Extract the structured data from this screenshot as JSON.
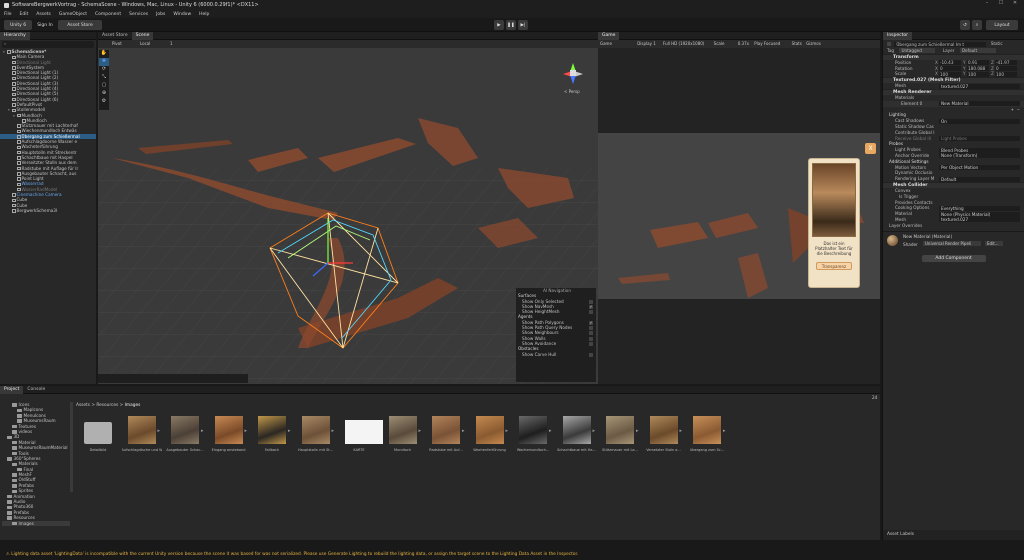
{
  "window": {
    "title": "SoftwareBergwerkVortrag - SchemaScene - Windows, Mac, Linux - Unity 6 (6000.0.29f1)* <DX11>"
  },
  "menu": [
    "File",
    "Edit",
    "Assets",
    "GameObject",
    "Component",
    "Services",
    "Jobs",
    "Window",
    "Help"
  ],
  "toolbar": {
    "unity": "Unity 6",
    "sign_in": "Sign In",
    "asset_store": "Asset Store",
    "layout": "Layout"
  },
  "hierarchy": {
    "tab": "Hierarchy",
    "items": [
      {
        "label": "SchemaScene*",
        "depth": 0,
        "style": "bold"
      },
      {
        "label": "Main Camera",
        "depth": 1,
        "style": ""
      },
      {
        "label": "Directional Light",
        "depth": 1,
        "style": "dim"
      },
      {
        "label": "EventSystem",
        "depth": 1,
        "style": ""
      },
      {
        "label": "Directional Light (1)",
        "depth": 1,
        "style": ""
      },
      {
        "label": "Directional Light (2)",
        "depth": 1,
        "style": ""
      },
      {
        "label": "Directional Light (3)",
        "depth": 1,
        "style": ""
      },
      {
        "label": "Directional Light (4)",
        "depth": 1,
        "style": ""
      },
      {
        "label": "Directional Light (5)",
        "depth": 1,
        "style": ""
      },
      {
        "label": "Directional Light (6)",
        "depth": 1,
        "style": ""
      },
      {
        "label": "DefaultPivot",
        "depth": 1,
        "style": ""
      },
      {
        "label": "Stollenmodell",
        "depth": 1,
        "style": ""
      },
      {
        "label": "Mundloch",
        "depth": 2,
        "style": ""
      },
      {
        "label": "Mundloch",
        "depth": 3,
        "style": ""
      },
      {
        "label": "Stützmauer mit Lachterhaf",
        "depth": 2,
        "style": ""
      },
      {
        "label": "Wiechenmundloch Entwäs",
        "depth": 2,
        "style": ""
      },
      {
        "label": "Übergang zum Schießermal",
        "depth": 2,
        "style": "sel"
      },
      {
        "label": "Aufschlagdoorne Wasser e",
        "depth": 2,
        "style": ""
      },
      {
        "label": "Wacheterführung",
        "depth": 2,
        "style": ""
      },
      {
        "label": "Hauptstolln mit Streckentr",
        "depth": 2,
        "style": ""
      },
      {
        "label": "Schachtbaue mit Haspel",
        "depth": 2,
        "style": ""
      },
      {
        "label": "Verseitzter Stolln aus dem",
        "depth": 2,
        "style": ""
      },
      {
        "label": "Radstube mit Auflage für Ir",
        "depth": 2,
        "style": ""
      },
      {
        "label": "Ausgebauter Schacht, aus",
        "depth": 2,
        "style": ""
      },
      {
        "label": "Point Light",
        "depth": 2,
        "style": ""
      },
      {
        "label": "Wasserrad",
        "depth": 2,
        "style": "blue"
      },
      {
        "label": "WasserRadModel",
        "depth": 2,
        "style": "dim"
      },
      {
        "label": "Cinemachine Camera",
        "depth": 1,
        "style": "blue"
      },
      {
        "label": "Cube",
        "depth": 1,
        "style": ""
      },
      {
        "label": "Cube",
        "depth": 1,
        "style": ""
      },
      {
        "label": "BergwerkSchema3I",
        "depth": 1,
        "style": ""
      }
    ]
  },
  "scene": {
    "tabs": [
      "Asset Store",
      "Scene"
    ],
    "pivot": "Pivot",
    "local": "Local",
    "grid_num": "1",
    "persp": "< Persp",
    "popup": {
      "text": "Das ist ein Platzhalter Text für die Beschreibung",
      "button": "Transparenz"
    },
    "navmesh": {
      "title": "AI Navigation",
      "sections": [
        {
          "head": "Surfaces",
          "items": [
            {
              "label": "Show Only Selected",
              "on": false
            },
            {
              "label": "Show NavMesh",
              "on": true
            },
            {
              "label": "Show HeightMesh",
              "on": false
            }
          ]
        },
        {
          "head": "Agents",
          "items": [
            {
              "label": "Show Path Polygons",
              "on": true
            },
            {
              "label": "Show Path Query Nodes",
              "on": false
            },
            {
              "label": "Show Neighbours",
              "on": false
            },
            {
              "label": "Show Walls",
              "on": false
            },
            {
              "label": "Show Avoidance",
              "on": false
            }
          ]
        },
        {
          "head": "Obstacles",
          "items": [
            {
              "label": "Show Carve Hull",
              "on": false
            }
          ]
        }
      ]
    }
  },
  "game": {
    "tab": "Game",
    "mode": "Game",
    "display": "Display 1",
    "res": "Full HD (1920x1080)",
    "scale": "Scale",
    "scale_val": "0.37x",
    "play": "Play Focused",
    "stats": "Stats",
    "gizmos": "Gizmos"
  },
  "inspector": {
    "tab": "Inspector",
    "name": "Übergang zum Schießermal Im t",
    "static": "Static",
    "tag_label": "Tag",
    "tag": "Untagged",
    "layer_label": "Layer",
    "layer": "Default",
    "transform": {
      "title": "Transform",
      "rows": [
        {
          "label": "Position",
          "x": "-10.43",
          "y": "0.91",
          "z": "-41.97"
        },
        {
          "label": "Rotation",
          "x": "0",
          "y": "180.088",
          "z": "0"
        },
        {
          "label": "Scale",
          "x": "100",
          "y": "100",
          "z": "100"
        }
      ]
    },
    "mesh_filter": {
      "title": "Textured.027 (Mesh Filter)",
      "mesh_label": "Mesh",
      "mesh": "textured.027"
    },
    "mesh_renderer": {
      "title": "Mesh Renderer",
      "materials": "Materials",
      "element": "Element 0",
      "material": "New Material",
      "lighting": "Lighting",
      "cast_label": "Cast Shadows",
      "cast": "On",
      "static_shadow": "Static Shadow Cas",
      "contrib": "Contribute Global I",
      "receive": "Receive Global Ill",
      "receive_val": "Light Probes",
      "probes": "Probes",
      "light_probes_label": "Light Probes",
      "light_probes": "Blend Probes",
      "anchor_label": "Anchor Override",
      "anchor": "None (Transform)",
      "additional": "Additional Settings",
      "motion_label": "Motion Vectors",
      "motion": "Per Object Motion",
      "dynamic": "Dynamic Occlusio",
      "rlayer_label": "Rendering Layer M",
      "rlayer": "Default"
    },
    "mesh_collider": {
      "title": "Mesh Collider",
      "convex": "Convex",
      "trigger": "Is Trigger",
      "contacts": "Provides Contacts",
      "cooking_label": "Cooking Options",
      "cooking": "Everything",
      "material_label": "Material",
      "material": "None (Physics Material)",
      "mesh_label": "Mesh",
      "mesh": "textured.027",
      "layer_overrides": "Layer Overrides"
    },
    "material": {
      "name": "New Material (Material)",
      "shader_label": "Shader",
      "shader": "Universal Render Pipeli",
      "edit": "Edit..."
    },
    "add_component": "Add Component",
    "asset_labels": "Asset Labels"
  },
  "project": {
    "tabs": [
      "Project",
      "Console"
    ],
    "breadcrumb": [
      "Assets",
      "Resources",
      "Images"
    ],
    "count": "24",
    "tree": [
      {
        "label": "Icons",
        "depth": 2
      },
      {
        "label": "Maplcons",
        "depth": 3
      },
      {
        "label": "Menulcons",
        "depth": 3
      },
      {
        "label": "MuseumsRaum",
        "depth": 3
      },
      {
        "label": "Textures",
        "depth": 2
      },
      {
        "label": "videos",
        "depth": 2
      },
      {
        "label": "3D",
        "depth": 1
      },
      {
        "label": "Material",
        "depth": 2
      },
      {
        "label": "MuseumsRaumMaterial",
        "depth": 2
      },
      {
        "label": "Tools",
        "depth": 2
      },
      {
        "label": "360°Spheres",
        "depth": 1
      },
      {
        "label": "Materials",
        "depth": 2
      },
      {
        "label": "Final",
        "depth": 3
      },
      {
        "label": "MeshF",
        "depth": 2
      },
      {
        "label": "OldStuff",
        "depth": 2
      },
      {
        "label": "Prefabs",
        "depth": 2
      },
      {
        "label": "Sprites",
        "depth": 2
      },
      {
        "label": "Animation",
        "depth": 1
      },
      {
        "label": "Audio",
        "depth": 1
      },
      {
        "label": "Photo360",
        "depth": 1
      },
      {
        "label": "Prefabs",
        "depth": 1
      },
      {
        "label": "Resources",
        "depth": 1
      },
      {
        "label": "Images",
        "depth": 2
      }
    ],
    "assets": [
      {
        "label": "Detailbild",
        "kind": "folder"
      },
      {
        "label": "Aufschlagrösche und We...",
        "kind": "img",
        "c1": "#6b4a2c",
        "c2": "#b08a5a"
      },
      {
        "label": "Ausgebauter Schac...",
        "kind": "img",
        "c1": "#4b4036",
        "c2": "#8a7a66"
      },
      {
        "label": "Eingang ansteband",
        "kind": "img",
        "c1": "#7a4a28",
        "c2": "#c98a54"
      },
      {
        "label": "Fallbach",
        "kind": "img",
        "c1": "#2a2622",
        "c2": "#c2984a"
      },
      {
        "label": "Hauptstolln mit St...",
        "kind": "img",
        "c1": "#6d5138",
        "c2": "#a88a66"
      },
      {
        "label": "KARTE",
        "kind": "map",
        "c1": "#f4f4f4",
        "c2": "#aaaaaa"
      },
      {
        "label": "Mundloch",
        "kind": "img",
        "c1": "#5a4a3a",
        "c2": "#9d8e76"
      },
      {
        "label": "Radstube mit Auf...",
        "kind": "img",
        "c1": "#7a5236",
        "c2": "#b2845a"
      },
      {
        "label": "Wachenferführung",
        "kind": "img",
        "c1": "#8a5a30",
        "c2": "#c48a50"
      },
      {
        "label": "Wachemundloch...",
        "kind": "img",
        "c1": "#1e1e1e",
        "c2": "#6a6a6a"
      },
      {
        "label": "Schachtbaue mit Ha...",
        "kind": "img",
        "c1": "#3a3a3a",
        "c2": "#a8a8a8"
      },
      {
        "label": "Stützmauer mit La...",
        "kind": "img",
        "c1": "#6b5a44",
        "c2": "#a89678"
      },
      {
        "label": "Versetzter Stoln a...",
        "kind": "img",
        "c1": "#6a4a2a",
        "c2": "#b08a5c"
      },
      {
        "label": "Übergang zum Sc...",
        "kind": "img",
        "c1": "#8a5a32",
        "c2": "#c8905a"
      }
    ]
  },
  "status": {
    "text": "Lighting data asset 'LightingData' is incompatible with the current Unity version because the scene it was based for was not serialized. Please use Generate Lighting to rebuild the lighting data, or assign the target scene to the Lighting Data Asset in the Inspector."
  }
}
